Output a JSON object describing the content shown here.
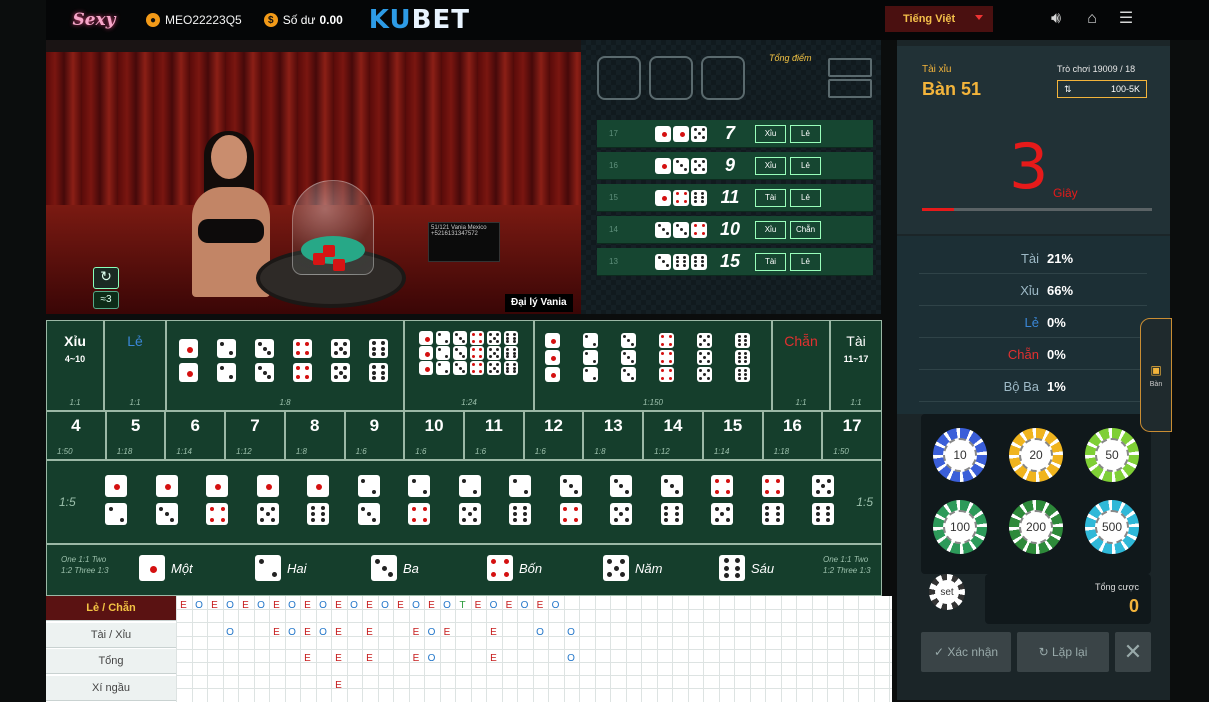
{
  "topbar": {
    "logo": "Sexy",
    "username": "MEO22223Q5",
    "balance_label": "Số dư",
    "balance": "0.00",
    "brand_a": "K",
    "brand_b": "U",
    "brand_c": "BET",
    "language": "Tiếng Việt"
  },
  "video": {
    "dealer_tag": "Đại lý Vania",
    "screen_text": "51/121 Vania Mexico +5216131347572",
    "signal": "3"
  },
  "history": {
    "total_label": "Tổng điểm",
    "rows": [
      {
        "round": "17",
        "dice": [
          1,
          1,
          5
        ],
        "total": "7",
        "a": "Xỉu",
        "b": "Lẻ"
      },
      {
        "round": "16",
        "dice": [
          1,
          3,
          5
        ],
        "total": "9",
        "a": "Xỉu",
        "b": "Lẻ"
      },
      {
        "round": "15",
        "dice": [
          1,
          4,
          6
        ],
        "total": "11",
        "a": "Tài",
        "b": "Lẻ"
      },
      {
        "round": "14",
        "dice": [
          3,
          3,
          4
        ],
        "total": "10",
        "a": "Xỉu",
        "b": "Chẵn"
      },
      {
        "round": "13",
        "dice": [
          3,
          6,
          6
        ],
        "total": "15",
        "a": "Tài",
        "b": "Lẻ"
      }
    ]
  },
  "panel": {
    "game": "Tài xỉu",
    "table": "Bàn 51",
    "round": "Trò chơi 19009 / 18",
    "limit": "100-5K",
    "countdown": "3",
    "countdown_unit": "Giây",
    "timer_fraction": 0.14,
    "stats": [
      {
        "label": "Tài",
        "value": "21%",
        "color": "#9db9c6"
      },
      {
        "label": "Xỉu",
        "value": "66%",
        "color": "#9db9c6"
      },
      {
        "label": "Lẻ",
        "value": "0%",
        "color": "#3a86d6"
      },
      {
        "label": "Chẵn",
        "value": "0%",
        "color": "#e23030"
      },
      {
        "label": "Bộ Ba",
        "value": "1%",
        "color": "#9db9c6"
      }
    ],
    "chips": [
      "10",
      "20",
      "50",
      "100",
      "200",
      "500"
    ],
    "set_label": "set",
    "total_bet_label": "Tổng cược",
    "total_bet": "0",
    "confirm": "Xác nhận",
    "repeat": "Lặp lại",
    "side_tab": "Bàn"
  },
  "board": {
    "xiu": "Xỉu",
    "xiu_range": "4~10",
    "le": "Lẻ",
    "chan": "Chẵn",
    "tai": "Tài",
    "tai_range": "11~17",
    "odds_1_1": "1:1",
    "odds_pair": "1:8",
    "odds_any": "1:24",
    "odds_triple": "1:150",
    "odds_combo": "1:5",
    "numbers": [
      {
        "n": "4",
        "o": "1:50"
      },
      {
        "n": "5",
        "o": "1:18"
      },
      {
        "n": "6",
        "o": "1:14"
      },
      {
        "n": "7",
        "o": "1:12"
      },
      {
        "n": "8",
        "o": "1:8"
      },
      {
        "n": "9",
        "o": "1:6"
      },
      {
        "n": "10",
        "o": "1:6"
      },
      {
        "n": "11",
        "o": "1:6"
      },
      {
        "n": "12",
        "o": "1:6"
      },
      {
        "n": "13",
        "o": "1:8"
      },
      {
        "n": "14",
        "o": "1:12"
      },
      {
        "n": "15",
        "o": "1:14"
      },
      {
        "n": "16",
        "o": "1:18"
      },
      {
        "n": "17",
        "o": "1:50"
      }
    ],
    "single_odds": "One 1:1 Two 1:2 Three 1:3",
    "singles": [
      "Một",
      "Hai",
      "Ba",
      "Bốn",
      "Năm",
      "Sáu"
    ]
  },
  "roadmap": {
    "labels": [
      "Lẻ / Chẵn",
      "Tài / Xỉu",
      "Tổng",
      "Xí ngầu"
    ],
    "row1": [
      "E",
      "O",
      "E",
      "O",
      "E",
      "O",
      "E",
      "O",
      "E",
      "O",
      "E",
      "O",
      "E",
      "O",
      "E",
      "O",
      "E",
      "O",
      "T",
      "E",
      "O",
      "E",
      "O",
      "E",
      "O"
    ],
    "row2": [
      "",
      "",
      "",
      "O",
      "",
      "",
      "E",
      "O",
      "E",
      "O",
      "E",
      "",
      "E",
      "",
      "",
      "E",
      "O",
      "E",
      "",
      "",
      "E",
      "",
      "",
      "O",
      "",
      "O"
    ],
    "row3": [
      "",
      "",
      "",
      "",
      "",
      "",
      "",
      "",
      "E",
      "",
      "E",
      "",
      "E",
      "",
      "",
      "E",
      "O",
      "",
      "",
      "",
      "E",
      "",
      "",
      "",
      "",
      "O"
    ],
    "row4": [
      "",
      "",
      "",
      "",
      "",
      "",
      "",
      "",
      "",
      "",
      "E",
      "",
      "",
      "",
      "",
      "",
      "",
      "",
      "",
      "",
      "",
      "",
      "",
      "",
      "",
      ""
    ]
  }
}
